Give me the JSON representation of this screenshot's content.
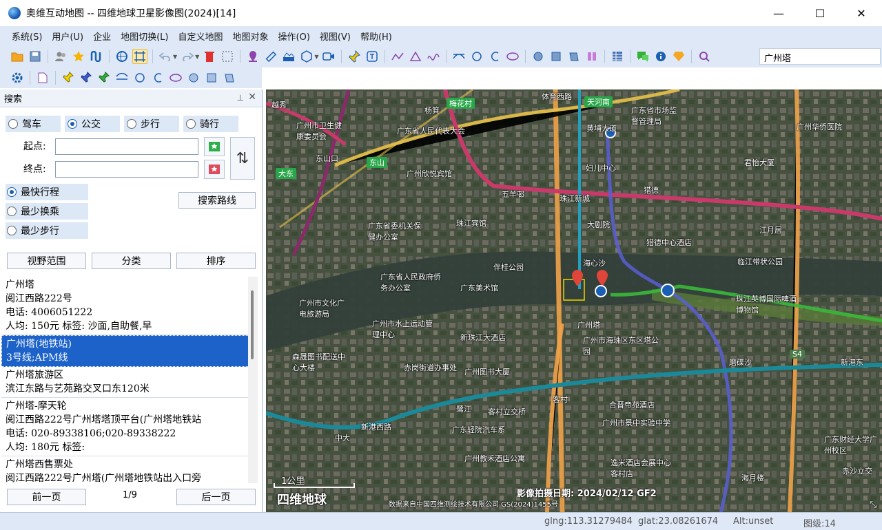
{
  "window": {
    "title": "奥维互动地图 -- 四维地球卫星影像图(2024)[14]",
    "minimize": "—",
    "maximize": "☐",
    "close": "✕"
  },
  "menu": [
    "系统(S)",
    "用户(U)",
    "企业",
    "地图切换(L)",
    "自定义地图",
    "地图对象",
    "操作(O)",
    "视图(V)",
    "帮助(H)"
  ],
  "toolbar": {
    "search_value": "广州塔"
  },
  "panel": {
    "title": "搜索",
    "modes": [
      "驾车",
      "公交",
      "步行",
      "骑行"
    ],
    "start_label": "起点:",
    "end_label": "终点:",
    "options": [
      "最快行程",
      "最少换乘",
      "最少步行"
    ],
    "search_route": "搜索路线",
    "btn_view": "视野范围",
    "btn_category": "分类",
    "btn_sort": "排序",
    "results": [
      [
        "广州塔",
        "阅江西路222号",
        "电话: 4006051222",
        "人均: 150元        标签: 沙面,自助餐,早"
      ],
      [
        "广州塔(地铁站)",
        "3号线;APM线"
      ],
      [
        "广州塔旅游区",
        "滨江东路与艺苑路交叉口东120米"
      ],
      [
        "广州塔-摩天轮",
        "阅江西路222号广州塔塔顶平台(广州塔地铁站",
        "电话: 020-89338106;020-89338222",
        "人均: 180元        标签:"
      ],
      [
        "广州塔西售票处",
        "阅江西路222号广州塔(广州塔地铁站出入口旁"
      ]
    ],
    "prev": "前一页",
    "page": "1/9",
    "next": "后一页"
  },
  "map": {
    "labels": {
      "l01": "越秀",
      "l02": "体育西路",
      "l03": "天河南",
      "l04": "广东省市场监督管理局",
      "l05": "广州市卫生健康委员会",
      "l06": "广东省人民代表大会",
      "l07": "杨箕",
      "l08": "梅花村",
      "l09": "黄埔大道",
      "l10": "广州华侨医院",
      "l11": "东山口",
      "l12": "东山",
      "l13": "大东",
      "l14": "广州欣悦宾馆",
      "l15": "妇儿中心",
      "l16": "君怡大厦",
      "l17": "五羊邨",
      "l18": "猎德",
      "l19": "珠江新城",
      "l20": "广东省委机关保健办公室",
      "l21": "珠江宾馆",
      "l22": "大剧院",
      "l23": "猎德中心酒店",
      "l24": "海心沙",
      "l25": "伴桂公园",
      "l26": "临江带状公园",
      "l27": "广东省人民政府侨务办公室",
      "l28": "广东美术馆",
      "l29": "广州市文化广电旅游局",
      "l30": "珠江英博国际啤酒博物馆",
      "l31": "广州塔",
      "l32": "广州市水上运动管理中心",
      "l33": "新珠江大酒店",
      "l34": "广州市海珠区东区塔公园",
      "l35": "森晟图书配送中心大楼",
      "l36": "赤岗街道办事处",
      "l37": "广州图书大厦",
      "l38": "客村",
      "l39": "合晋帝苑酒店",
      "l40": "鹭江",
      "l41": "客村立交桥",
      "l42": "广州市景中实验中学",
      "l43": "广东轻院汽车系",
      "l44": "广州教禾酒店公寓",
      "l45": "逸米酒店会展中心客村店",
      "l46": "海月楼",
      "l47": "广东财经大学广州校区",
      "l48": "新港东",
      "l49": "磨碟沙",
      "l50": "江月居",
      "l51": "中大",
      "l52": "新港西路",
      "l53": "赤沙立交",
      "l54": "S4"
    },
    "scale": "1公里",
    "logo": "四维地球",
    "capture_date": "影像拍摄日期: 2024/02/12 GF2",
    "copyright": "数据来自中国四维测绘技术有限公司 GS(2024)1455号"
  },
  "status": {
    "lng": "glng:113.31279484",
    "lat": "glat:23.08261674",
    "alt": "Alt:unset",
    "level": "图级:14"
  },
  "colors": {
    "menubar": "#dfe8f6",
    "selected": "#1c62c8",
    "panel_radio_bg": "#dde8f6"
  }
}
